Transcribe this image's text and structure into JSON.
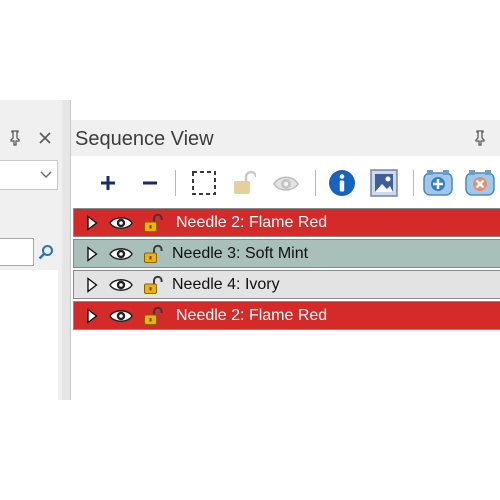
{
  "window": {
    "panel_title": "Sequence View"
  },
  "left_panel": {
    "combo_value": "",
    "search_value": ""
  },
  "toolbar": {
    "buttons": [
      {
        "icon": "plus-icon"
      },
      {
        "icon": "minus-icon"
      },
      {
        "icon": "select-rectangle-icon"
      },
      {
        "icon": "unlock-icon"
      },
      {
        "icon": "eye-icon"
      },
      {
        "icon": "info-icon"
      },
      {
        "icon": "image-icon"
      },
      {
        "icon": "add-hoop-icon"
      },
      {
        "icon": "remove-hoop-icon"
      }
    ]
  },
  "sequence": {
    "rows": [
      {
        "label": "Needle 2: Flame Red",
        "color": "#d42a2a"
      },
      {
        "label": "Needle 3: Soft Mint",
        "color": "#a9bfba"
      },
      {
        "label": "Needle 4: Ivory",
        "color": "#e3e3e3"
      },
      {
        "label": "Needle 2: Flame Red",
        "color": "#d42a2a"
      }
    ]
  },
  "colors": {
    "panel_bg": "#f0f0f0",
    "info_blue": "#1565c0",
    "lock_gold": "#d99a00"
  }
}
